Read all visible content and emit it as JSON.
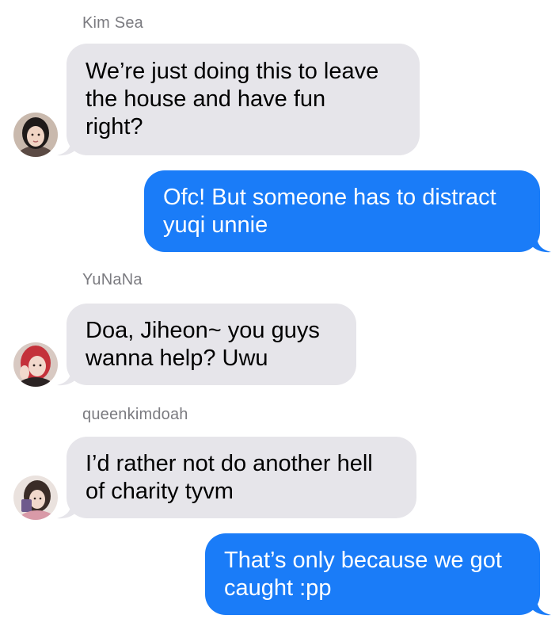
{
  "colors": {
    "incoming_bubble": "#e6e5ea",
    "outgoing_bubble": "#1a7cf8",
    "sender_name": "#7b7b80"
  },
  "messages": [
    {
      "sender": "Kim Sea",
      "direction": "incoming",
      "text": "We’re just doing this to leave\nthe house and have fun\nright?",
      "avatar": "kim-sea-avatar"
    },
    {
      "direction": "outgoing",
      "text": "Ofc! But someone has to distract\nyuqi unnie"
    },
    {
      "sender": "YuNaNa",
      "direction": "incoming",
      "text": "Doa, Jiheon~ you guys\nwanna help? Uwu",
      "avatar": "yunana-avatar"
    },
    {
      "sender": "queenkimdoah",
      "direction": "incoming",
      "text": "I’d rather not do another hell\nof charity tyvm",
      "avatar": "queenkimdoah-avatar"
    },
    {
      "direction": "outgoing",
      "text": "That’s only because we got\ncaught :pp"
    }
  ]
}
